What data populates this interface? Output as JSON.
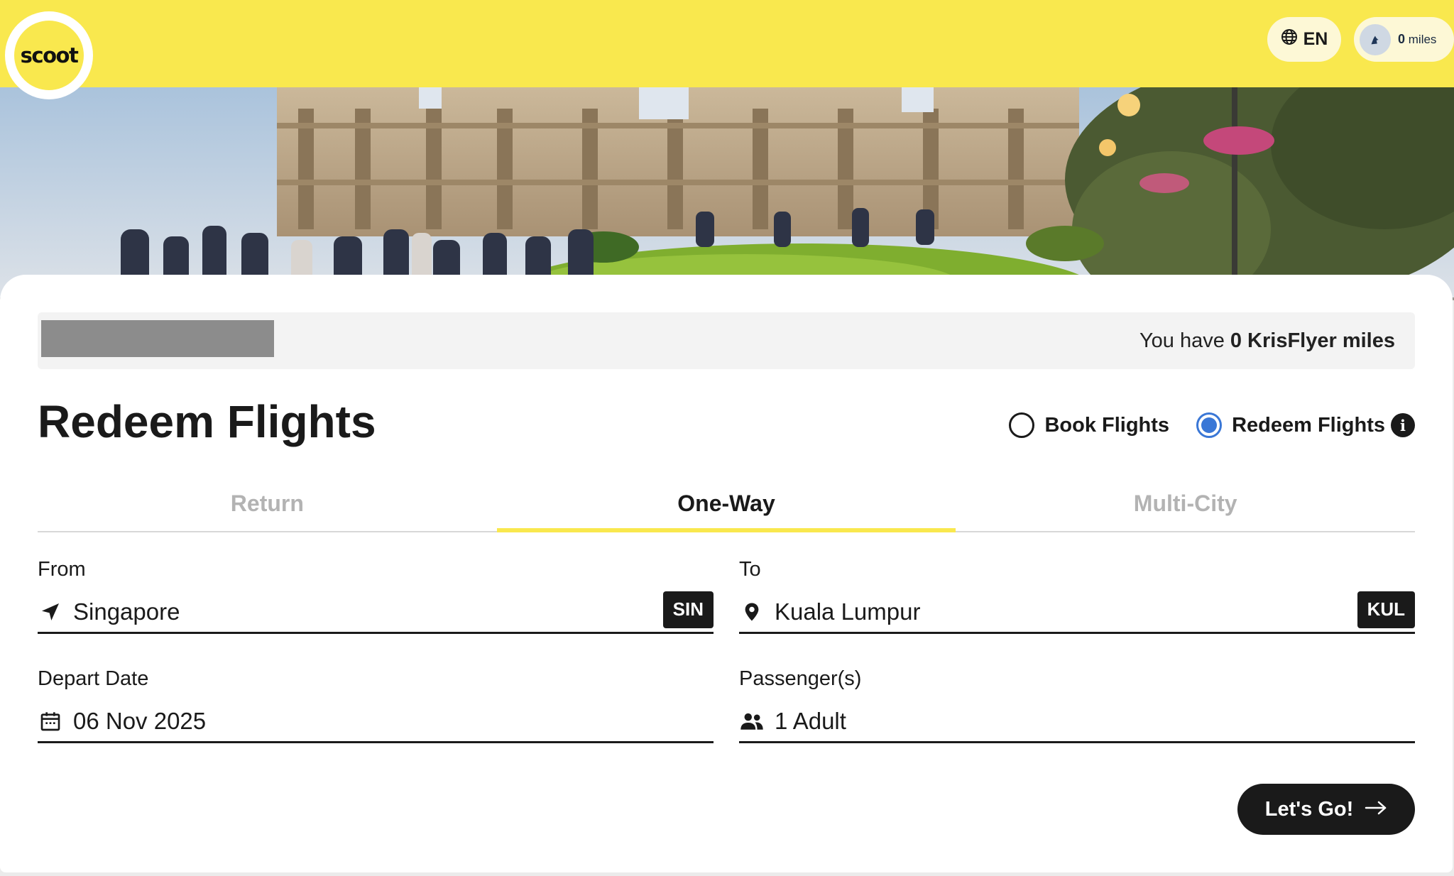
{
  "header": {
    "logo_text": "scoot",
    "language": "EN",
    "miles": {
      "count": "0",
      "unit": "miles"
    }
  },
  "banner": {
    "prefix": "You have",
    "miles_value": "0 KrisFlyer miles"
  },
  "form": {
    "title": "Redeem Flights",
    "modes": [
      {
        "label": "Book Flights",
        "selected": false
      },
      {
        "label": "Redeem Flights",
        "selected": true
      }
    ],
    "tabs": [
      {
        "label": "Return",
        "active": false
      },
      {
        "label": "One-Way",
        "active": true
      },
      {
        "label": "Multi-City",
        "active": false
      }
    ],
    "from": {
      "label": "From",
      "value": "Singapore",
      "code": "SIN",
      "icon": "navigation-arrow-icon"
    },
    "to": {
      "label": "To",
      "value": "Kuala Lumpur",
      "code": "KUL",
      "icon": "map-pin-icon"
    },
    "depart": {
      "label": "Depart Date",
      "value": "06 Nov 2025",
      "icon": "calendar-icon"
    },
    "passengers": {
      "label": "Passenger(s)",
      "value": "1 Adult",
      "icon": "people-icon"
    },
    "submit_label": "Let's Go!"
  },
  "colors": {
    "brand_yellow": "#f9e84e",
    "radio_blue": "#3a77d6",
    "dark": "#1a1a1a"
  }
}
